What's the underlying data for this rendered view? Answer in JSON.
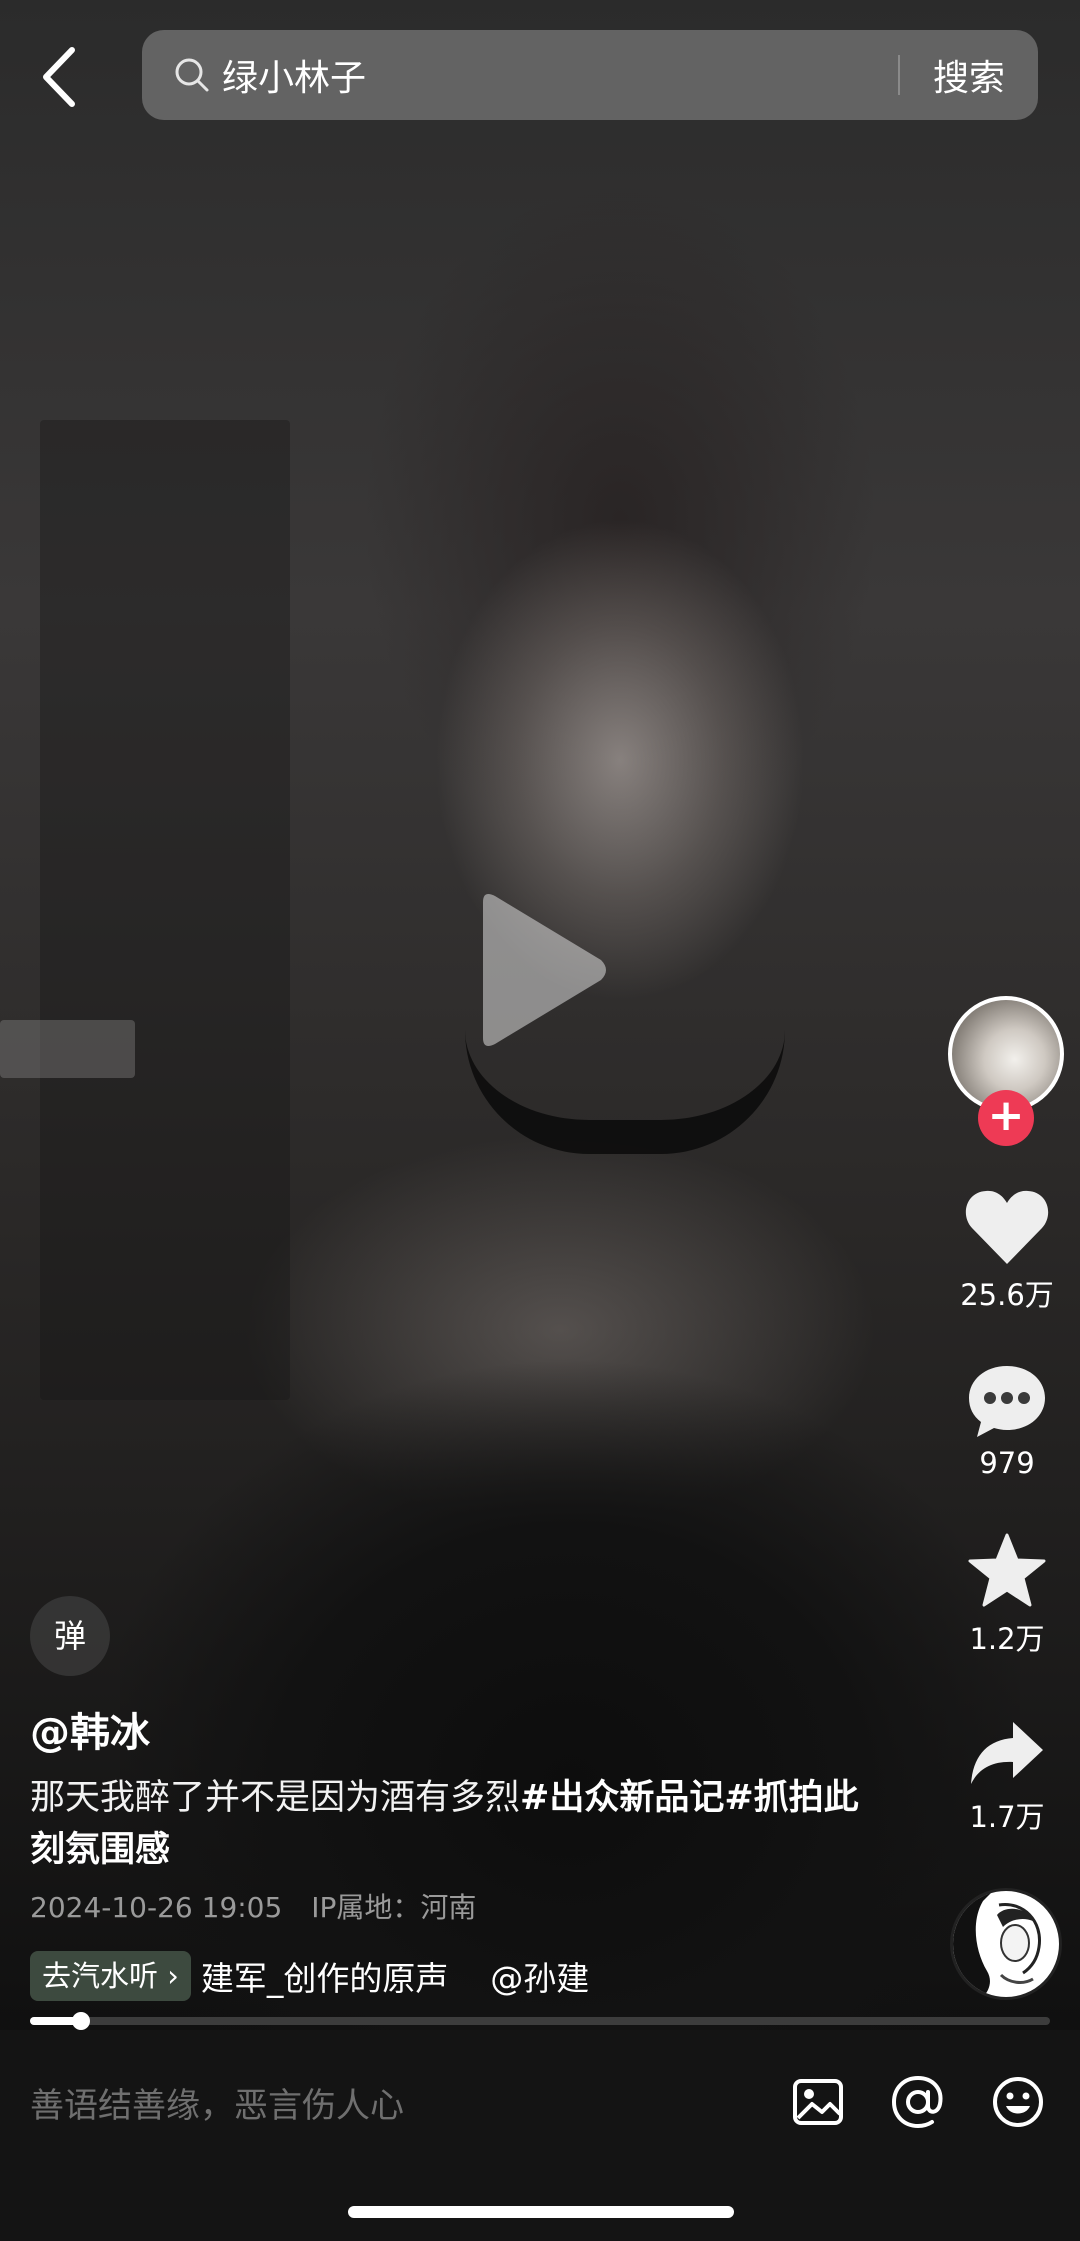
{
  "search": {
    "query": "绿小林子",
    "button_label": "搜索"
  },
  "actions": {
    "likes": "25.6万",
    "comments": "979",
    "favorites": "1.2万",
    "shares": "1.7万"
  },
  "video": {
    "danmaku_label": "弹",
    "author": "@韩冰",
    "caption_text": "那天我醉了并不是因为酒有多烈",
    "caption_tags": "#出众新品记#抓拍此刻氛围感",
    "date": "2024-10-26 19:05",
    "ip_location": "IP属地：河南",
    "qishui_button": "去汽水听",
    "music_text": "建军_创作的原声    @孙建",
    "progress_fraction": 0.05
  },
  "comment_bar": {
    "placeholder": "善语结善缘，恶言伤人心"
  },
  "icons": {
    "back": "chevron-left-icon",
    "search": "search-icon",
    "play": "play-icon",
    "like": "heart-icon",
    "comment": "comment-bubble-icon",
    "favorite": "star-icon",
    "share": "share-arrow-icon",
    "image": "image-icon",
    "mention": "at-icon",
    "emoji": "emoji-icon"
  },
  "colors": {
    "follow_plus": "#ee3a55",
    "qishui_button_bg": "#3d4a3f"
  }
}
